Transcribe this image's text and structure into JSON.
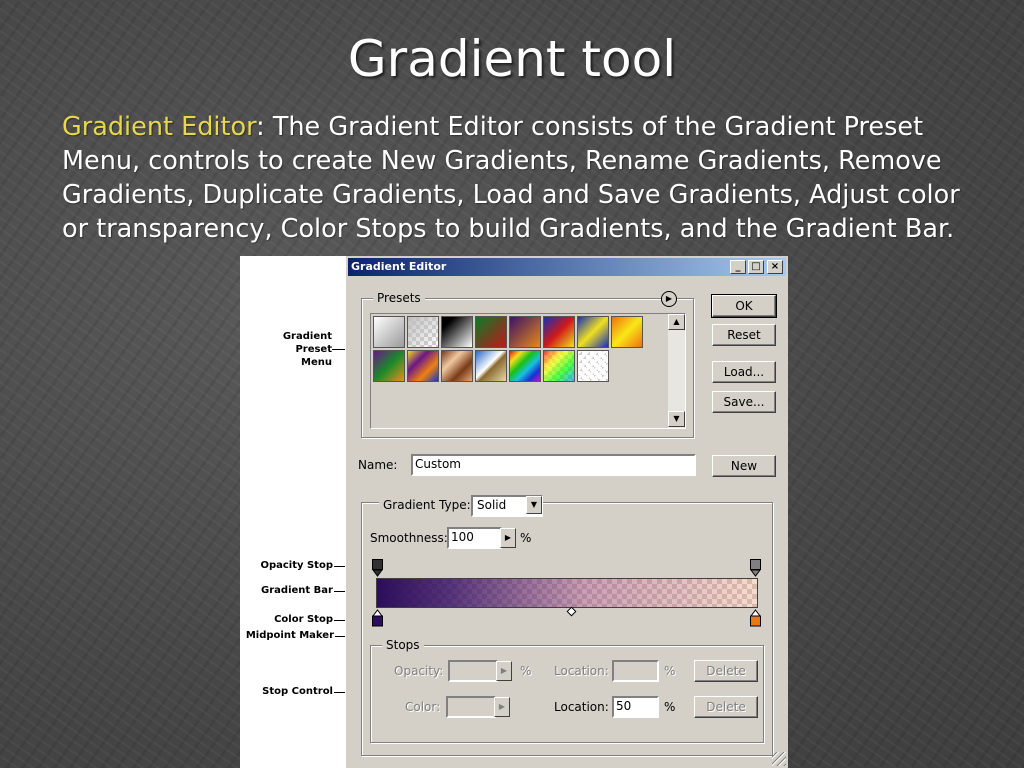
{
  "slide": {
    "title": "Gradient tool",
    "body_highlight": "Gradient Editor",
    "body_text": ": The Gradient Editor consists of the Gradient Preset Menu, controls to create New Gradients, Rename Gradients, Remove Gradients, Duplicate Gradients, Load and Save Gradients, Adjust color or transparency, Color Stops to build Gradients, and the Gradient Bar."
  },
  "callouts": {
    "preset_menu_1": "Gradient",
    "preset_menu_2": "Preset",
    "preset_menu_3": "Menu",
    "opacity_stop": "Opacity Stop",
    "gradient_bar": "Gradient Bar",
    "color_stop": "Color Stop",
    "midpoint": "Midpoint Maker",
    "stop_control": "Stop Control"
  },
  "dialog": {
    "title": "Gradient Editor",
    "window_buttons": {
      "minimize": "_",
      "maximize": "□",
      "close": "×"
    },
    "presets_label": "Presets",
    "buttons": {
      "ok": "OK",
      "reset": "Reset",
      "load": "Load...",
      "save": "Save...",
      "new": "New"
    },
    "name_label": "Name:",
    "name_value": "Custom",
    "gradient_type_label": "Gradient Type:",
    "gradient_type_value": "Solid",
    "smoothness_label": "Smoothness:",
    "smoothness_value": "100",
    "percent": "%",
    "stops_label": "Stops",
    "opacity_label": "Opacity:",
    "opacity_value": "",
    "opacity_location_label": "Location:",
    "opacity_location_value": "",
    "color_label": "Color:",
    "color_location_label": "Location:",
    "color_location_value": "50",
    "delete_label": "Delete"
  },
  "presets": [
    {
      "name": "foreground-to-background",
      "bg": "linear-gradient(135deg,#ffffff,#9a9a9a)"
    },
    {
      "name": "foreground-to-transparent",
      "bg": "linear-gradient(135deg,#c0c0c0,rgba(255,255,255,0)), repeating-conic-gradient(#fff 0% 25%,#ccc 0% 50%) 0 0/8px 8px"
    },
    {
      "name": "black-white",
      "bg": "linear-gradient(135deg,#000 20%,#fff 100%)"
    },
    {
      "name": "red-green",
      "bg": "linear-gradient(135deg,#0a7a2a,#c01818)"
    },
    {
      "name": "violet-orange",
      "bg": "linear-gradient(135deg,#3a1466,#e8881a)"
    },
    {
      "name": "blue-red-yellow",
      "bg": "linear-gradient(135deg,#1430b8,#d01818,#f0e020)"
    },
    {
      "name": "blue-yellow-blue",
      "bg": "linear-gradient(135deg,#1830b8,#f0e020,#1830b8)"
    },
    {
      "name": "orange-yellow-orange",
      "bg": "linear-gradient(135deg,#f07010,#f8e818,#f07010)"
    },
    {
      "name": "violet-green-orange",
      "bg": "linear-gradient(135deg,#6a1888,#1a8a2a,#e8901a)"
    },
    {
      "name": "yellow-violet-orange-blue",
      "bg": "linear-gradient(135deg,#f0d820,#6a1888,#f08010,#1838b8)"
    },
    {
      "name": "copper",
      "bg": "linear-gradient(135deg,#7a3a18,#f0c8a0,#7a3a18,#e0a878)"
    },
    {
      "name": "chrome",
      "bg": "linear-gradient(135deg,#2868c8,#ffffff 45%,#8a6a30 55%,#e8d8a8)"
    },
    {
      "name": "spectrum",
      "bg": "linear-gradient(135deg,#e01818,#f0e020,#18c018,#18c0e0,#1830d8,#c018c0)"
    },
    {
      "name": "transparent-rainbow",
      "bg": "linear-gradient(135deg,rgba(255,0,0,.7),rgba(255,255,0,.7),rgba(0,255,0,.7),rgba(0,150,255,.7)), repeating-conic-gradient(#fff 0% 25%,#ccc 0% 50%) 0 0/8px 8px"
    },
    {
      "name": "transparent-stripes",
      "bg": "repeating-linear-gradient(135deg,rgba(255,255,255,.9) 0 3px,transparent 3px 6px), repeating-conic-gradient(#fff 0% 25%,#ccc 0% 50%) 0 0/8px 8px"
    }
  ],
  "colors": {
    "opacity_stop_fill": "#303030",
    "color_stop_left": "#2b0d5a",
    "color_stop_right": "#e87818",
    "highlight_text": "#e6d84a"
  }
}
